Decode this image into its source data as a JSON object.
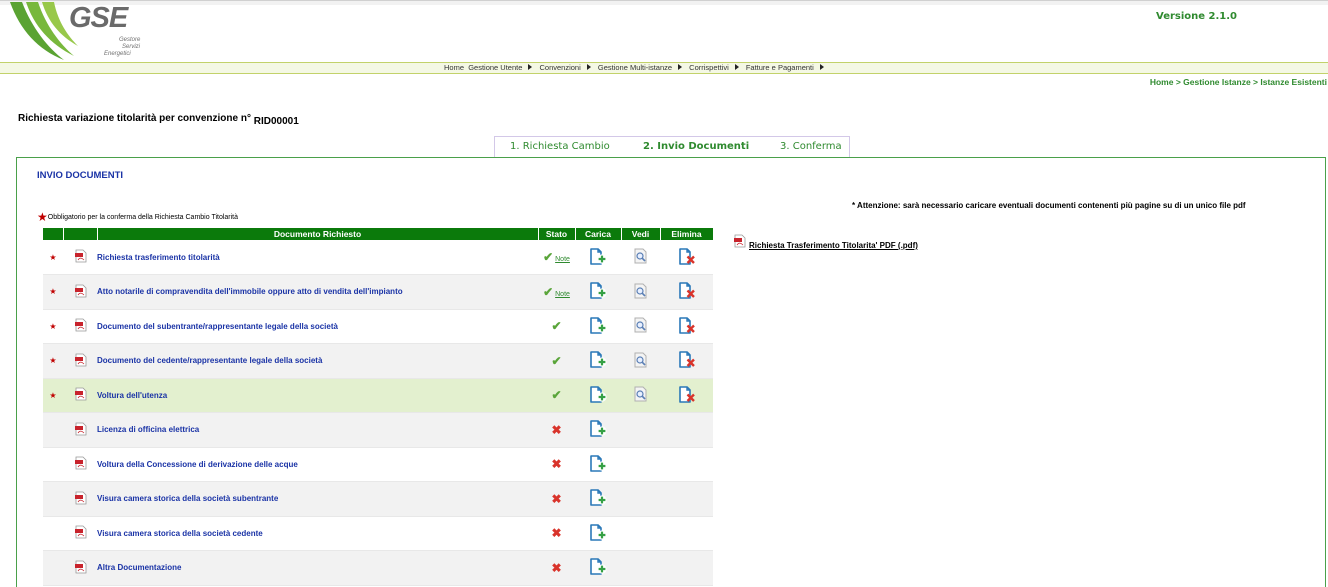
{
  "header": {
    "logo_text": "GSE",
    "logo_sub": [
      "Gestore",
      "Servizi",
      "Energetici"
    ],
    "version": "Versione 2.1.0"
  },
  "menu": {
    "items": [
      "Home",
      "Gestione Utente",
      "Convenzioni",
      "Gestione Multi-istanze",
      "Corrispettivi",
      "Fatture e Pagamenti"
    ]
  },
  "breadcrumb": "Home > Gestione Istanze > Istanze Esistenti",
  "page": {
    "title": "Richiesta variazione titolarità per convenzione n°",
    "rid": "RID00001"
  },
  "steps": [
    "1. Richiesta Cambio",
    "2. Invio Documenti",
    "3. Conferma"
  ],
  "section": {
    "title": "INVIO DOCUMENTI",
    "attention": "* Attenzione: sarà necessario caricare eventuali documenti contenenti più pagine su di un unico file pdf",
    "legend": "Obbligatorio per la conferma della Richiesta Cambio Titolarità"
  },
  "table": {
    "headers": [
      "Documento Richiesto",
      "Stato",
      "Carica",
      "Vedi",
      "Elimina"
    ],
    "note_label": "Note",
    "rows": [
      {
        "name": "Richiesta trasferimento titolarità",
        "required": true,
        "status": "ok",
        "note": true,
        "vedi": true,
        "elimina": true
      },
      {
        "name": "Atto notarile di compravendita dell'immobile oppure atto di vendita dell'impianto",
        "required": true,
        "status": "ok",
        "note": true,
        "vedi": true,
        "elimina": true
      },
      {
        "name": "Documento del subentrante/rappresentante legale della società",
        "required": true,
        "status": "ok",
        "note": false,
        "vedi": true,
        "elimina": true
      },
      {
        "name": "Documento del cedente/rappresentante legale della società",
        "required": true,
        "status": "ok",
        "note": false,
        "vedi": true,
        "elimina": true
      },
      {
        "name": "Voltura dell'utenza",
        "required": true,
        "status": "ok",
        "note": false,
        "vedi": true,
        "elimina": true
      },
      {
        "name": "Licenza di officina elettrica",
        "required": false,
        "status": "missing",
        "note": false,
        "vedi": false,
        "elimina": false
      },
      {
        "name": "Voltura della Concessione di derivazione delle acque",
        "required": false,
        "status": "missing",
        "note": false,
        "vedi": false,
        "elimina": false
      },
      {
        "name": "Visura camera storica della società subentrante",
        "required": false,
        "status": "missing",
        "note": false,
        "vedi": false,
        "elimina": false
      },
      {
        "name": "Visura camera storica della società cedente",
        "required": false,
        "status": "missing",
        "note": false,
        "vedi": false,
        "elimina": false
      },
      {
        "name": "Altra Documentazione",
        "required": false,
        "status": "missing",
        "note": false,
        "vedi": false,
        "elimina": false
      }
    ]
  },
  "side": {
    "download_link": "Richiesta Trasferimento Titolarita' PDF (.pdf)"
  },
  "colors": {
    "brand_green": "#0b7a0b",
    "link_blue": "#1a33a6",
    "required_red": "#c00000",
    "selected_row": "#e3f0cf"
  }
}
